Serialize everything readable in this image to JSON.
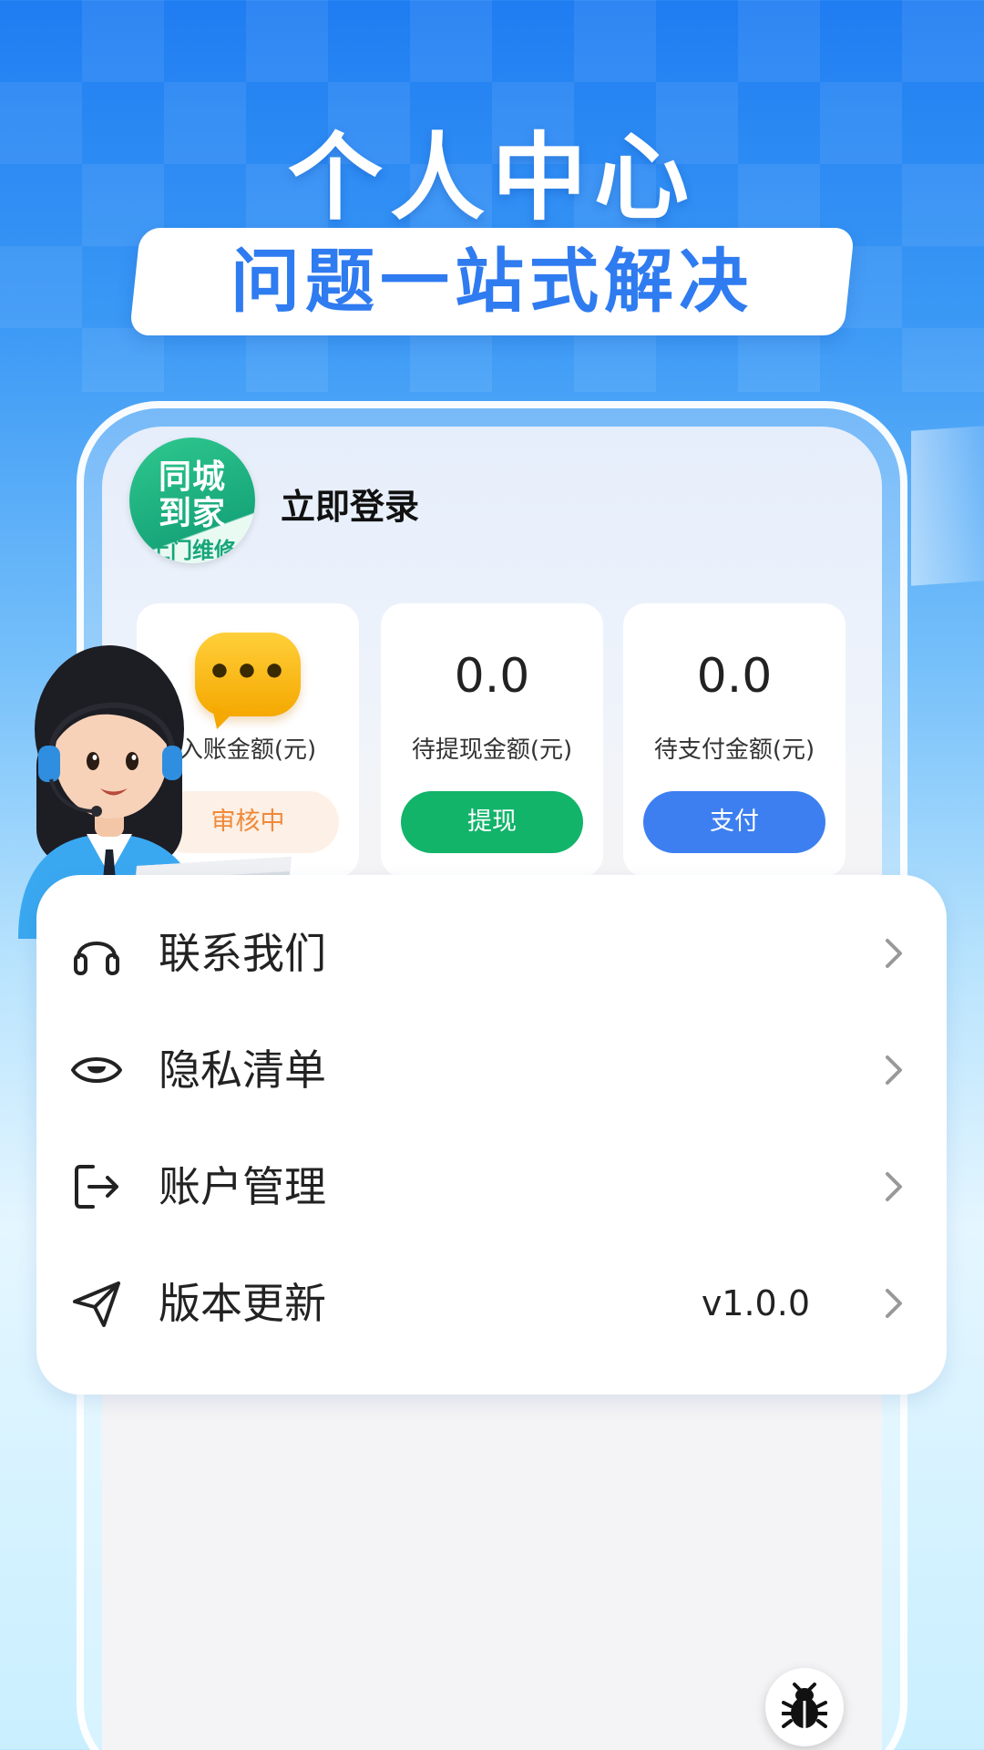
{
  "hero": {
    "title": "个人中心",
    "banner": "问题一站式解决"
  },
  "profile": {
    "logo_line1": "同城",
    "logo_line2": "到家",
    "logo_line3": "上门维修",
    "login": "立即登录"
  },
  "stats": [
    {
      "value": "",
      "label": "入账金额(元)",
      "button": "审核中"
    },
    {
      "value": "0.0",
      "label": "待提现金额(元)",
      "button": "提现"
    },
    {
      "value": "0.0",
      "label": "待支付金额(元)",
      "button": "支付"
    }
  ],
  "chat": {
    "dots": "•••"
  },
  "menu": [
    {
      "label": "联系我们",
      "icon": "headset-icon",
      "value": ""
    },
    {
      "label": "隐私清单",
      "icon": "eye-icon",
      "value": ""
    },
    {
      "label": "账户管理",
      "icon": "logout-icon",
      "value": ""
    },
    {
      "label": "版本更新",
      "icon": "send-icon",
      "value": "v1.0.0"
    }
  ],
  "colors": {
    "withdraw": "#12b46a",
    "pay": "#3d7ff0",
    "review_bg": "#fdf0e6",
    "review_text": "#f08a3a",
    "banner_text": "#2f7bf0"
  }
}
